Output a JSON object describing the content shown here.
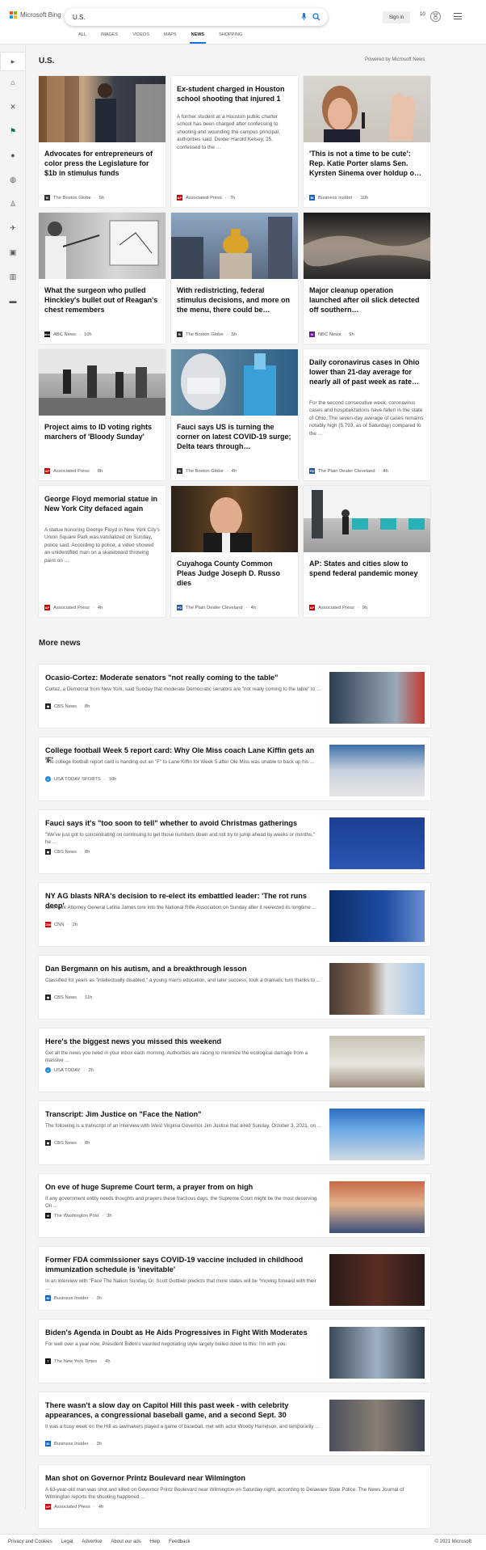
{
  "header": {
    "logo_text": "Microsoft Bing",
    "search_value": "U.S.",
    "signin": "Sign in",
    "reward_count": "10",
    "tabs": [
      "ALL",
      "IMAGES",
      "VIDEOS",
      "MAPS",
      "NEWS",
      "SHOPPING"
    ],
    "active_tab": "NEWS",
    "accent": "#1a73e8"
  },
  "section": {
    "title": "U.S.",
    "powered": "Powered by Microsoft News"
  },
  "cards": [
    {
      "title": "Advocates for entrepreneurs of color press the Legislature for $1b in stimulus funds",
      "body": "",
      "source": "The Boston Globe",
      "time": "6h"
    },
    {
      "title": "Ex-student charged in Houston school shooting that injured 1",
      "body": "A former student at a Houston public charter school has been charged after confessing to shooting and wounding the campus principal, authorities said. Dexter Harold Kelsey, 25, confessed to the …",
      "source": "Associated Press",
      "time": "7h"
    },
    {
      "title": "'This is not a time to be cute': Rep. Katie Porter slams Sen. Kyrsten Sinema over holdup o…",
      "body": "",
      "source": "Business Insider",
      "time": "10h"
    },
    {
      "title": "What the surgeon who pulled Hinckley's bullet out of Reagan's chest remembers",
      "body": "",
      "source": "ABC News",
      "time": "10h"
    },
    {
      "title": "With redistricting, federal stimulus decisions, and more on the menu, there could be…",
      "body": "",
      "source": "The Boston Globe",
      "time": "5h"
    },
    {
      "title": "Major cleanup operation launched after oil slick detected off southern…",
      "body": "",
      "source": "NBC News",
      "time": "9h"
    },
    {
      "title": "Project aims to ID voting rights marchers of 'Bloody Sunday'",
      "body": "",
      "source": "Associated Press",
      "time": "8h"
    },
    {
      "title": "Fauci says US is turning the corner on latest COVID-19 surge; Delta tears through…",
      "body": "",
      "source": "The Boston Globe",
      "time": "4h"
    },
    {
      "title": "Daily coronavirus cases in Ohio lower than 21-day average for nearly all of past week as rate…",
      "body": "For the second consecutive week, coronavirus cases and hospitalizations have fallen in the state of Ohio. The seven-day average of cases remains notably high (5,793, as of Saturday) compared to the …",
      "source": "The Plain Dealer Cleveland",
      "time": "4h"
    },
    {
      "title": "George Floyd memorial statue in New York City defaced again",
      "body": "A statue honoring George Floyd in New York City's Union Square Park was vandalized on Sunday, police said. According to police, a video showed an unidentified man on a skateboard throwing paint on …",
      "source": "Associated Press",
      "time": "4h"
    },
    {
      "title": "Cuyahoga County Common Pleas Judge Joseph D. Russo dies",
      "body": "",
      "source": "The Plain Dealer Cleveland",
      "time": "4h"
    },
    {
      "title": "AP: States and cities slow to spend federal pandemic money",
      "body": "",
      "source": "Associated Press",
      "time": "9h"
    }
  ],
  "more": {
    "title": "More news",
    "items": [
      {
        "title": "Ocasio-Cortez: Moderate senators \"not really coming to the table\"",
        "body": "Cortez, a Democrat from New York, said Sunday that moderate Democratic senators are \"not really coming to the table\" to ...",
        "source": "CBS News",
        "time": "8h"
      },
      {
        "title": "College football Week 5 report card: Why Ole Miss coach Lane Kiffin gets an 'F'",
        "body": "The college football report card is handing out an \"F\" to Lane Kiffin for Week 5 after Ole Miss was unable to back up his ...",
        "source": "USA TODAY SPORTS",
        "time": "10h"
      },
      {
        "title": "Fauci says it's \"too soon to tell\" whether to avoid Christmas gatherings",
        "body": "\"We've just got to concentrating on continuing to get those numbers down and not try to jump ahead by weeks or months,\" he ...",
        "source": "CBS News",
        "time": "8h"
      },
      {
        "title": "NY AG blasts NRA's decision to re-elect its embattled leader: 'The rot runs deep'",
        "body": "New York Attorney General Letitia James tore into the National Rifle Association on Sunday after it reelected its longtime ...",
        "source": "CNN",
        "time": "2h"
      },
      {
        "title": "Dan Bergmann on his autism, and a breakthrough lesson",
        "body": "Classified for years as \"intellectually disabled,\" a young man's education, and later success, took a dramatic turn thanks to ...",
        "source": "CBS News",
        "time": "11h"
      },
      {
        "title": "Here's the biggest news you missed this weekend",
        "body": "Get all the news you need in your inbox each morning. Authorities are racing to minimize the ecological damage from a massive ...",
        "source": "USA TODAY",
        "time": "2h"
      },
      {
        "title": "Transcript: Jim Justice on \"Face the Nation\"",
        "body": "The following is a transcript of an interview with West Virginia Governor Jim Justice that aired Sunday, October 3, 2021, on ...",
        "source": "CBS News",
        "time": "8h"
      },
      {
        "title": "On eve of huge Supreme Court term, a prayer from on high",
        "body": "If any government entity needs thoughts and prayers these fractious days, the Supreme Court might be the most deserving. On ...",
        "source": "The Washington Post",
        "time": "3h"
      },
      {
        "title": "Former FDA commissioner says COVID-19 vaccine included in childhood immunization schedule is 'inevitable'",
        "body": "In an interview with \"Face The Nation Sunday, Dr. Scott Gottlieb predicts that more states will be \"moving forward with their ...",
        "source": "Business Insider",
        "time": "3h"
      },
      {
        "title": "Biden's Agenda in Doubt as He Aids Progressives in Fight With Moderates",
        "body": "For well over a year now, President Biden's vaunted negotiating style largely boiled down to this: I'm with you.",
        "source": "The New York Times",
        "time": "4h"
      },
      {
        "title": "There wasn't a slow day on Capitol Hill this past week - with celebrity appearances, a congressional baseball game, and a second Sept. 30",
        "body": "It was a busy week on the Hill as lawmakers played a game of baseball, met with actor Woody Harrelson, and temporarily ...",
        "source": "Business Insider",
        "time": "3h"
      },
      {
        "title": "Man shot on Governor Printz Boulevard near Wilmington",
        "body": "A 63-year-old man was shot and killed on Governor Printz Boulevard near Wilmington on Saturday night, according to Delaware State Police. The News Journal of Wilmington reports the shooting happened ...",
        "source": "Associated Press",
        "time": "4h"
      }
    ]
  },
  "footer": {
    "links": [
      "Privacy and Cookies",
      "Legal",
      "Advertise",
      "About our ads",
      "Help",
      "Feedback"
    ],
    "copyright": "© 2021 Microsoft"
  }
}
